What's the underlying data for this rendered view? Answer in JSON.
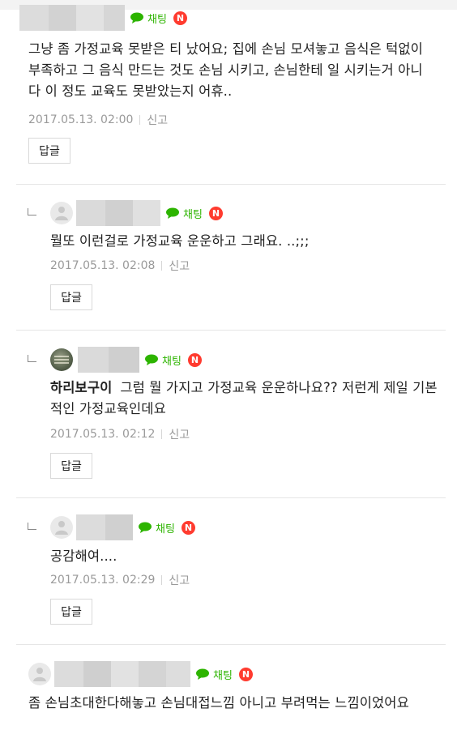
{
  "colors": {
    "chat_green": "#2db400",
    "new_red": "#ff3b2f",
    "meta_gray": "#9a9a9a"
  },
  "icons": {
    "chat": "chat-bubble-icon",
    "new": "new-badge",
    "reply_arrow": "reply-arrow-icon"
  },
  "chat_label": "채팅",
  "new_label": "N",
  "report_label": "신고",
  "reply_label": "답글",
  "comments": [
    {
      "text": "그냥 좀 가정교육 못받은 티 났어요; 집에 손님 모셔놓고 음식은 턱없이 부족하고 그 음식 만드는 것도 손님 시키고, 손님한테 일 시키는거 아니다 이 정도 교육도 못받았는지 어휴..",
      "time": "2017.05.13. 02:00"
    },
    {
      "text": "뭘또 이런걸로 가정교육 운운하고 그래요. ..;;;",
      "time": "2017.05.13. 02:08"
    },
    {
      "mention": "하리보구이",
      "text": "그럼 뭘 가지고 가정교육 운운하나요?? 저런게 제일 기본적인 가정교육인데요",
      "time": "2017.05.13. 02:12"
    },
    {
      "text": "공감해여....",
      "time": "2017.05.13. 02:29"
    },
    {
      "text": "좀 손님초대한다해놓고 손님대접느낌 아니고 부려먹는 느낌이었어요"
    }
  ]
}
